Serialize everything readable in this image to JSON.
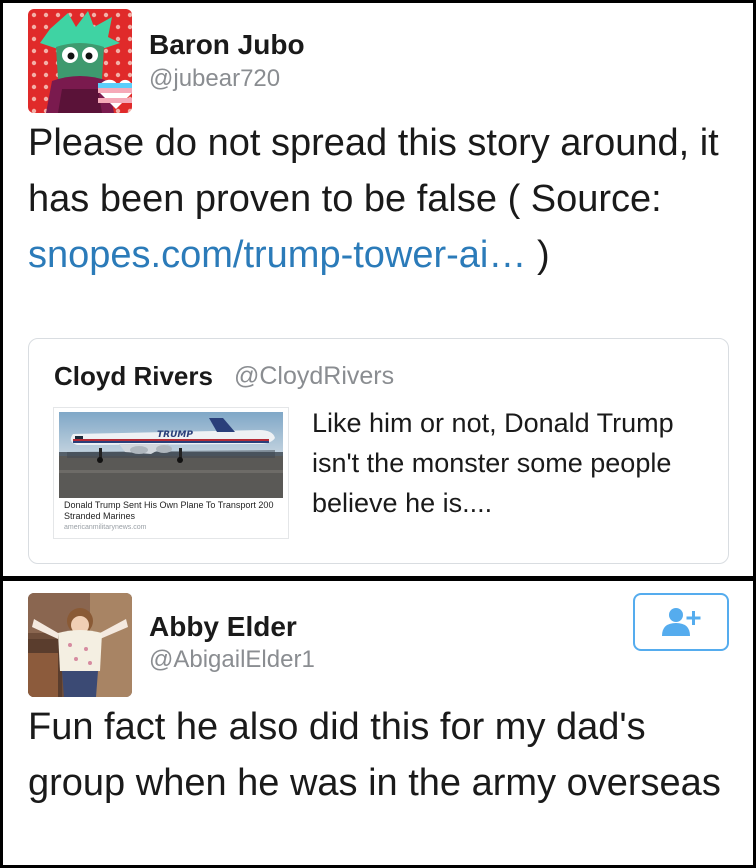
{
  "tweet1": {
    "name": "Baron Jubo",
    "handle": "@jubear720",
    "text_before_link": "Please do not spread this story around, it has been proven to be false ( Source: ",
    "link_text": "snopes.com/trump-tower-ai…",
    "text_after_link": " )",
    "avatar_icon": "cartoon-avatar-icon"
  },
  "quote": {
    "name": "Cloyd Rivers",
    "handle": "@CloydRivers",
    "text": "Like him or not, Donald Trump isn't the monster some people believe he is....",
    "card": {
      "title": "Donald Trump Sent His Own Plane To Transport 200 Stranded Marines",
      "source": "americanmilitarynews.com",
      "plane_livery": "TRUMP"
    }
  },
  "tweet2": {
    "name": "Abby Elder",
    "handle": "@AbigailElder1",
    "text": "Fun fact he also did this for my dad's group when he was in the army overseas",
    "follow_icon": "add-user-icon",
    "avatar_icon": "photo-avatar-icon"
  },
  "colors": {
    "link": "#2b7bb9",
    "follow_border": "#55acee",
    "handle_gray": "#8a8d91"
  }
}
